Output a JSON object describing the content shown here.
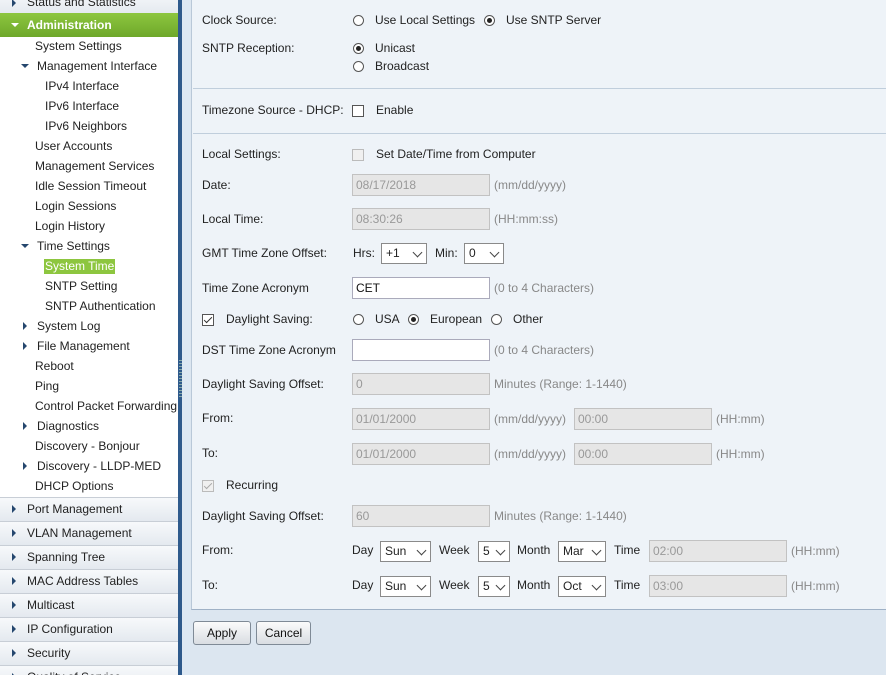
{
  "sidebar": {
    "top_partial": "Status and Statistics",
    "admin": "Administration",
    "items": {
      "system_settings": "System Settings",
      "management_interface": "Management Interface",
      "ipv4_interface": "IPv4 Interface",
      "ipv6_interface": "IPv6 Interface",
      "ipv6_neighbors": "IPv6 Neighbors",
      "user_accounts": "User Accounts",
      "management_services": "Management Services",
      "idle_session_timeout": "Idle Session Timeout",
      "login_sessions": "Login Sessions",
      "login_history": "Login History",
      "time_settings": "Time Settings",
      "system_time": "System Time",
      "sntp_setting": "SNTP Setting",
      "sntp_authentication": "SNTP Authentication",
      "system_log": "System Log",
      "file_management": "File Management",
      "reboot": "Reboot",
      "ping": "Ping",
      "control_packet_forwarding": "Control Packet Forwarding",
      "diagnostics": "Diagnostics",
      "discovery_bonjour": "Discovery - Bonjour",
      "discovery_lldp_med": "Discovery - LLDP-MED",
      "dhcp_options": "DHCP Options"
    },
    "sections": {
      "port_management": "Port Management",
      "vlan_management": "VLAN Management",
      "spanning_tree": "Spanning Tree",
      "mac_address_tables": "MAC Address Tables",
      "multicast": "Multicast",
      "ip_configuration": "IP Configuration",
      "security": "Security",
      "quality_of_service_partial": "Quality of Service"
    }
  },
  "form": {
    "clock_source": {
      "label": "Clock Source:",
      "opt_local": "Use Local Settings",
      "opt_sntp": "Use SNTP Server"
    },
    "sntp_reception": {
      "label": "SNTP Reception:",
      "opt_unicast": "Unicast",
      "opt_broadcast": "Broadcast"
    },
    "timezone_source": {
      "label": "Timezone Source - DHCP:",
      "enable": "Enable"
    },
    "local_settings": {
      "label": "Local Settings:",
      "set_from_computer": "Set Date/Time from Computer"
    },
    "date": {
      "label": "Date:",
      "value": "08/17/2018",
      "hint": "(mm/dd/yyyy)"
    },
    "local_time": {
      "label": "Local Time:",
      "value": "08:30:26",
      "hint": "(HH:mm:ss)"
    },
    "gmt_offset": {
      "label": "GMT Time Zone Offset:",
      "hrs_label": "Hrs:",
      "hrs_value": "+1",
      "min_label": "Min:",
      "min_value": "0"
    },
    "tz_acronym": {
      "label": "Time Zone Acronym",
      "value": "CET",
      "hint": "(0 to 4 Characters)"
    },
    "daylight_saving": {
      "label": "Daylight Saving:",
      "opt_usa": "USA",
      "opt_european": "European",
      "opt_other": "Other"
    },
    "dst_acronym": {
      "label": "DST Time Zone Acronym",
      "value": "",
      "hint": "(0 to 4 Characters)"
    },
    "ds_offset": {
      "label": "Daylight Saving Offset:",
      "value": "0",
      "hint": "Minutes (Range: 1-1440)"
    },
    "from": {
      "label": "From:",
      "date": "01/01/2000",
      "date_hint": "(mm/dd/yyyy)",
      "time": "00:00",
      "time_hint": "(HH:mm)"
    },
    "to": {
      "label": "To:",
      "date": "01/01/2000",
      "date_hint": "(mm/dd/yyyy)",
      "time": "00:00",
      "time_hint": "(HH:mm)"
    },
    "recurring": {
      "label": "Recurring"
    },
    "ds_offset2": {
      "label": "Daylight Saving Offset:",
      "value": "60",
      "hint": "Minutes (Range: 1-1440)"
    },
    "rec_from": {
      "label": "From:",
      "day_label": "Day",
      "day": "Sun",
      "week_label": "Week",
      "week": "5",
      "month_label": "Month",
      "month": "Mar",
      "time_label": "Time",
      "time": "02:00",
      "time_hint": "(HH:mm)"
    },
    "rec_to": {
      "label": "To:",
      "day_label": "Day",
      "day": "Sun",
      "week_label": "Week",
      "week": "5",
      "month_label": "Month",
      "month": "Oct",
      "time_label": "Time",
      "time": "03:00",
      "time_hint": "(HH:mm)"
    }
  },
  "buttons": {
    "apply": "Apply",
    "cancel": "Cancel"
  }
}
